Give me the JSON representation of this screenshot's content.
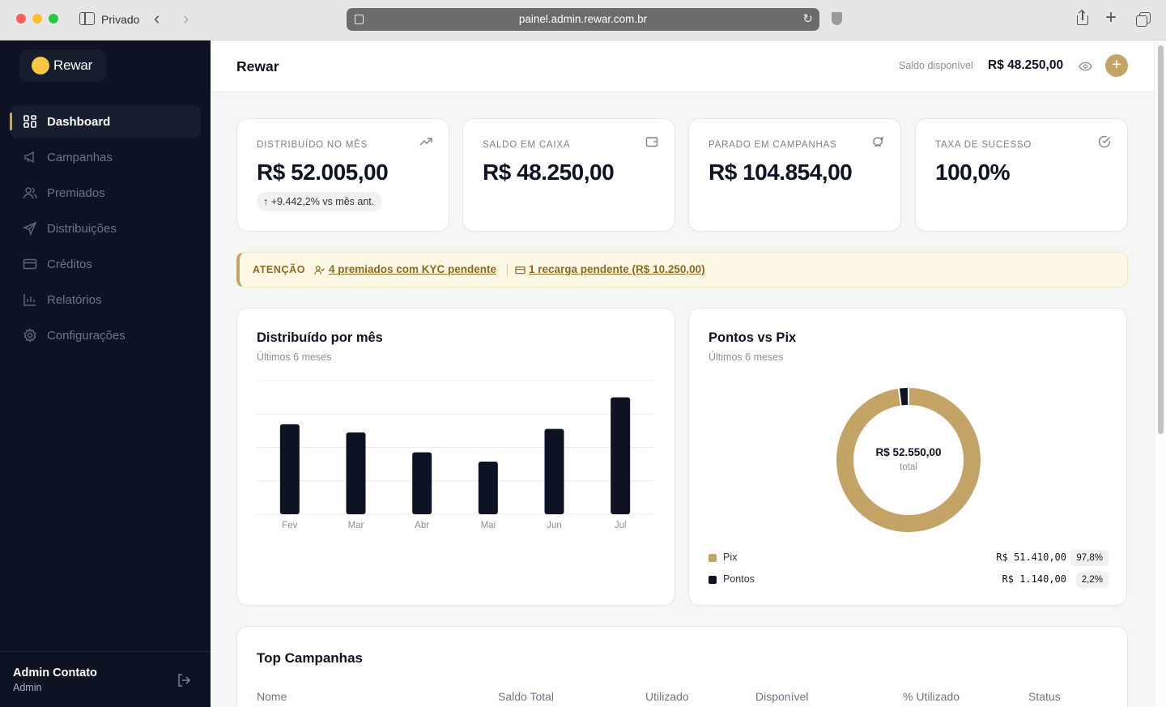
{
  "browser": {
    "private_label": "Privado",
    "url": "painel.admin.rewar.com.br"
  },
  "sidebar": {
    "brand": "Rewar",
    "items": [
      {
        "label": "Dashboard",
        "icon": "grid-icon",
        "active": true
      },
      {
        "label": "Campanhas",
        "icon": "megaphone-icon"
      },
      {
        "label": "Premiados",
        "icon": "users-icon"
      },
      {
        "label": "Distribuições",
        "icon": "send-icon"
      },
      {
        "label": "Créditos",
        "icon": "card-icon"
      },
      {
        "label": "Relatórios",
        "icon": "chart-icon"
      },
      {
        "label": "Configurações",
        "icon": "gear-icon"
      }
    ],
    "user": {
      "name": "Admin Contato",
      "role": "Admin"
    }
  },
  "header": {
    "title": "Rewar",
    "balance_label": "Saldo disponível",
    "balance_value": "R$ 48.250,00",
    "add_label": "+"
  },
  "stats": [
    {
      "label": "Distribuído no mês",
      "value": "R$ 52.005,00",
      "delta": "+9.442,2% vs mês ant.",
      "icon": "trending-up-icon"
    },
    {
      "label": "Saldo em caixa",
      "value": "R$ 48.250,00",
      "icon": "wallet-icon"
    },
    {
      "label": "Parado em campanhas",
      "value": "R$ 104.854,00",
      "icon": "piggy-bank-icon"
    },
    {
      "label": "Taxa de sucesso",
      "value": "100,0%",
      "icon": "check-circle-icon"
    }
  ],
  "alert": {
    "title": "ATENÇÃO",
    "kyc_link": "4 premiados com KYC pendente",
    "recharge_link": "1 recarga pendente (R$ 10.250,00)"
  },
  "charts": {
    "monthly": {
      "title": "Distribuído por mês",
      "subtitle": "Últimos 6 meses"
    },
    "split": {
      "title": "Pontos vs Pix",
      "subtitle": "Últimos 6 meses",
      "center_value": "R$ 52.550,00",
      "center_label": "total",
      "legend": [
        {
          "name": "Pix",
          "amount": "R$ 51.410,00",
          "pct": "97,8%",
          "color": "#c3a466"
        },
        {
          "name": "Pontos",
          "amount": "R$ 1.140,00",
          "pct": "2,2%",
          "color": "#0d1322"
        }
      ]
    }
  },
  "chart_data": [
    {
      "type": "bar",
      "categories": [
        "Fev",
        "Mar",
        "Abr",
        "Mai",
        "Jun",
        "Jul"
      ],
      "values": [
        0.77,
        0.7,
        0.53,
        0.45,
        0.73,
        1.0
      ],
      "ylim": [
        0,
        1.15
      ],
      "grid": true,
      "bar_color": "#0d1322"
    },
    {
      "type": "pie",
      "donut": true,
      "labels": [
        "Pix",
        "Pontos"
      ],
      "values": [
        51410,
        1140
      ],
      "colors": [
        "#c3a466",
        "#0d1322"
      ]
    }
  ],
  "table": {
    "title": "Top Campanhas",
    "columns": [
      "Nome",
      "Saldo Total",
      "Utilizado",
      "Disponível",
      "% Utilizado",
      "Status"
    ]
  }
}
